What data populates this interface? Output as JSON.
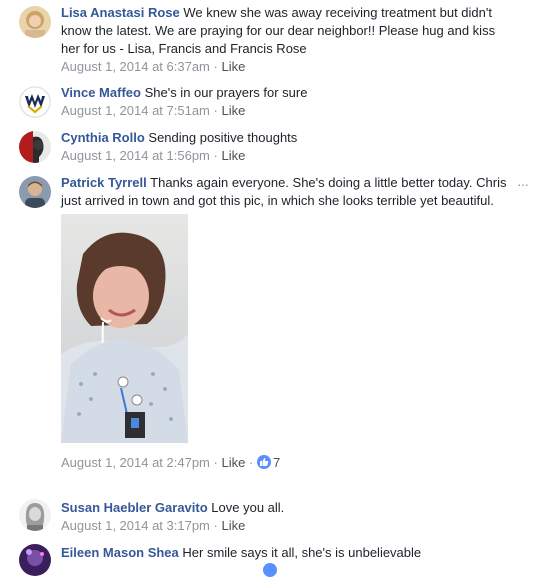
{
  "comments": [
    {
      "author": "Lisa Anastasi Rose",
      "text": "We knew she was away receiving treatment but didn't know the latest. We are praying for our dear neighbor!! Please hug and kiss her for us - Lisa, Francis and Francis Rose",
      "timestamp": "August 1, 2014 at 6:37am",
      "like_label": "Like",
      "avatar_icon": "woman-avatar-icon"
    },
    {
      "author": "Vince Maffeo",
      "text": "She's in our prayers for sure",
      "timestamp": "August 1, 2014 at 7:51am",
      "like_label": "Like",
      "avatar_icon": "wvu-logo-avatar-icon"
    },
    {
      "author": "Cynthia Rollo",
      "text": "Sending positive thoughts",
      "timestamp": "August 1, 2014 at 1:56pm",
      "like_label": "Like",
      "avatar_icon": "red-silhouette-avatar-icon"
    },
    {
      "author": "Patrick Tyrrell",
      "text": "Thanks again everyone. She's doing a little better today. Chris just arrived in town and got this pic, in which she looks terrible yet beautiful.",
      "timestamp": "August 1, 2014 at 2:47pm",
      "like_label": "Like",
      "like_count": "7",
      "avatar_icon": "man-avatar-icon",
      "options_label": "···"
    },
    {
      "author": "Susan Haebler Garavito",
      "text": "Love you all.",
      "timestamp": "August 1, 2014 at 3:17pm",
      "like_label": "Like",
      "avatar_icon": "grayscale-woman-avatar-icon"
    },
    {
      "author": "Eileen Mason Shea",
      "text": "Her smile says it all, she's is unbelievable",
      "avatar_icon": "purple-avatar-icon"
    }
  ],
  "separator": "·",
  "colors": {
    "author_link": "#365899",
    "meta_text": "#90949c",
    "like_blue": "#5890ff"
  }
}
